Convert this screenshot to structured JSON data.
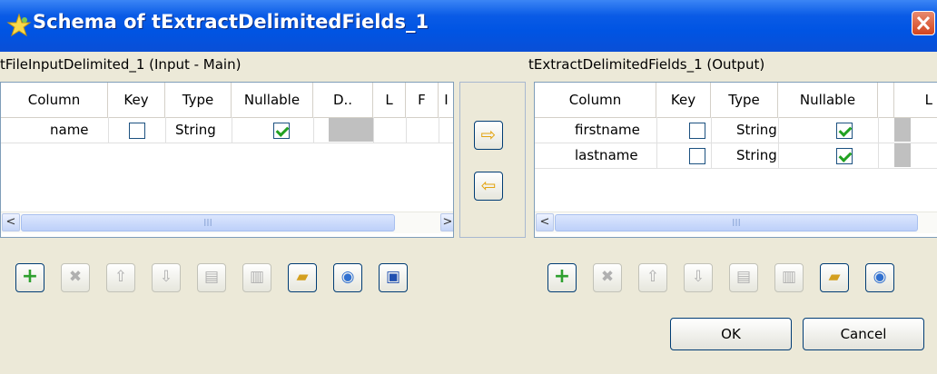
{
  "window": {
    "title": "Schema of tExtractDelimitedFields_1"
  },
  "left_panel": {
    "title": "tFileInputDelimited_1 (Input - Main)",
    "columns": [
      "Column",
      "Key",
      "Type",
      "Nullable",
      "D..",
      "L",
      "F",
      "I"
    ],
    "rows": [
      {
        "column": "name",
        "key": false,
        "type": "String",
        "nullable": true
      }
    ]
  },
  "right_panel": {
    "title": "tExtractDelimitedFields_1 (Output)",
    "columns": [
      "Column",
      "Key",
      "Type",
      "Nullable",
      "L"
    ],
    "rows": [
      {
        "column": "firstname",
        "key": false,
        "type": "String",
        "nullable": true
      },
      {
        "column": "lastname",
        "key": false,
        "type": "String",
        "nullable": true
      }
    ]
  },
  "scroll": {
    "left_arrow": "<",
    "right_arrow": ">",
    "thumb_grip": "III"
  },
  "toolbar_icons": [
    "add-icon",
    "remove-icon",
    "move-up-icon",
    "move-down-icon",
    "copy-icon",
    "paste-icon",
    "import-icon",
    "export-icon",
    "save-icon"
  ],
  "buttons": {
    "ok": "OK",
    "cancel": "Cancel"
  }
}
